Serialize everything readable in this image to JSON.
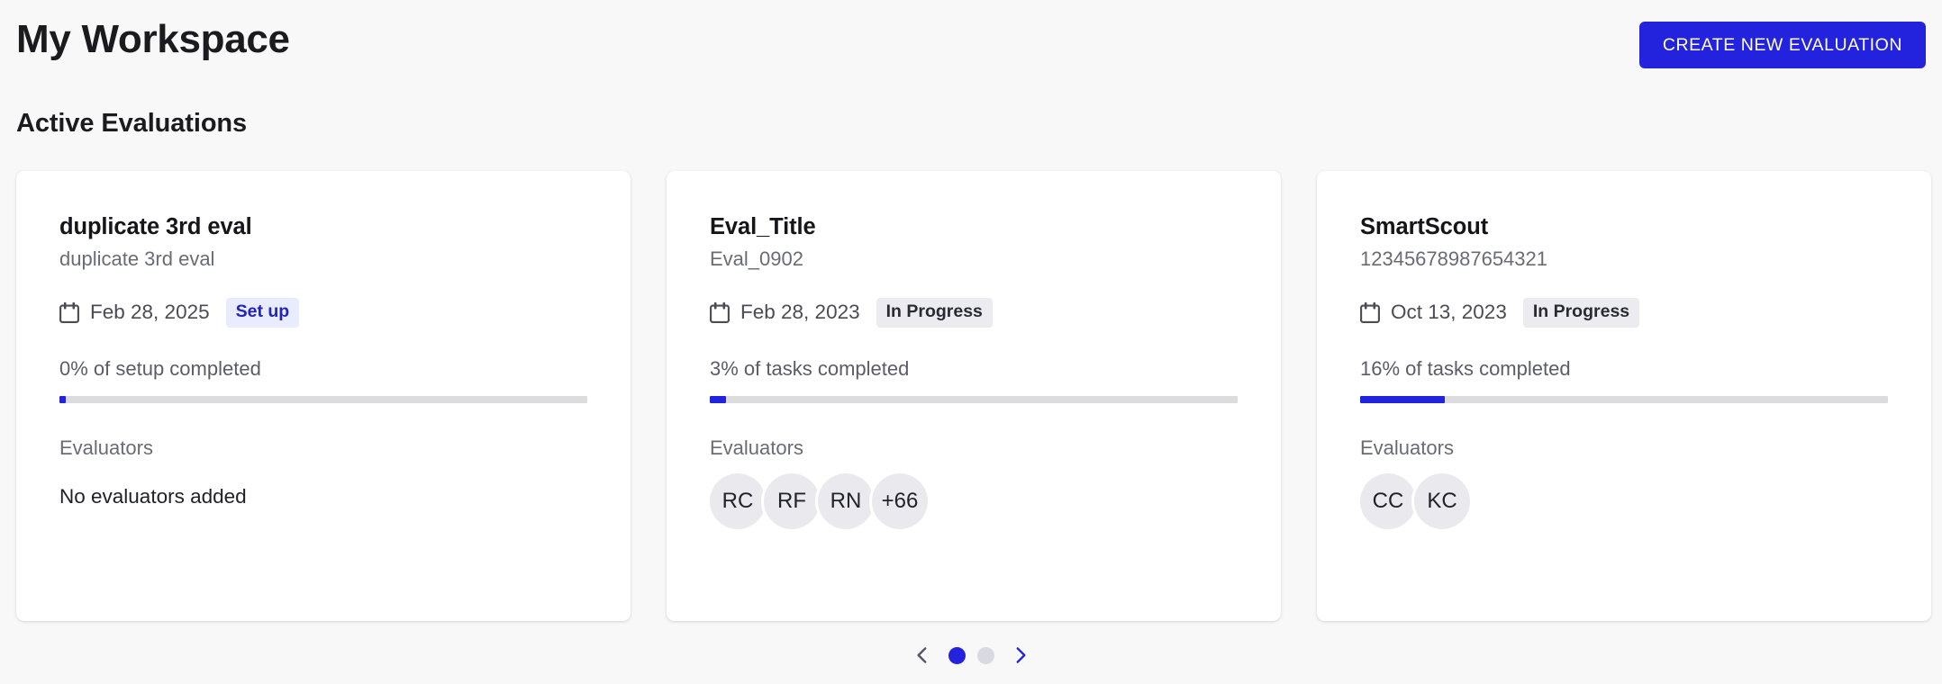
{
  "header": {
    "title": "My Workspace",
    "create_button_label": "CREATE NEW EVALUATION",
    "section_title": "Active Evaluations"
  },
  "colors": {
    "accent_blue": "#2323dd",
    "page_background": "#f8f8f9",
    "card_background": "#ffffff",
    "progress_track": "#dcdcdf",
    "badge_setup_bg": "#e8ecfd",
    "badge_setup_text": "#2323b8",
    "badge_inprogress_bg": "#ececf0",
    "badge_inprogress_text": "#2a2a33",
    "avatar_bg": "#eaeaee",
    "muted_text": "#6b6b76"
  },
  "cards": [
    {
      "title": "duplicate 3rd eval",
      "subtitle": "duplicate 3rd eval",
      "date": "Feb 28, 2025",
      "status": "Set up",
      "status_kind": "setup",
      "progress_label": "0% of setup completed",
      "progress_percent": 0,
      "evaluators_label": "Evaluators",
      "empty_evaluators_text": "No evaluators added",
      "evaluators": []
    },
    {
      "title": "Eval_Title",
      "subtitle": "Eval_0902",
      "date": "Feb 28, 2023",
      "status": "In Progress",
      "status_kind": "inprogress",
      "progress_label": "3% of tasks completed",
      "progress_percent": 3,
      "evaluators_label": "Evaluators",
      "empty_evaluators_text": "",
      "evaluators": [
        "RC",
        "RF",
        "RN",
        "+66"
      ]
    },
    {
      "title": "SmartScout",
      "subtitle": "12345678987654321",
      "date": "Oct 13, 2023",
      "status": "In Progress",
      "status_kind": "inprogress",
      "progress_label": "16% of tasks completed",
      "progress_percent": 16,
      "evaluators_label": "Evaluators",
      "empty_evaluators_text": "",
      "evaluators": [
        "CC",
        "KC"
      ]
    }
  ],
  "pagination": {
    "prev_icon": "chevron-left-icon",
    "next_icon": "chevron-right-icon",
    "total_pages": 2,
    "active_page": 1
  }
}
